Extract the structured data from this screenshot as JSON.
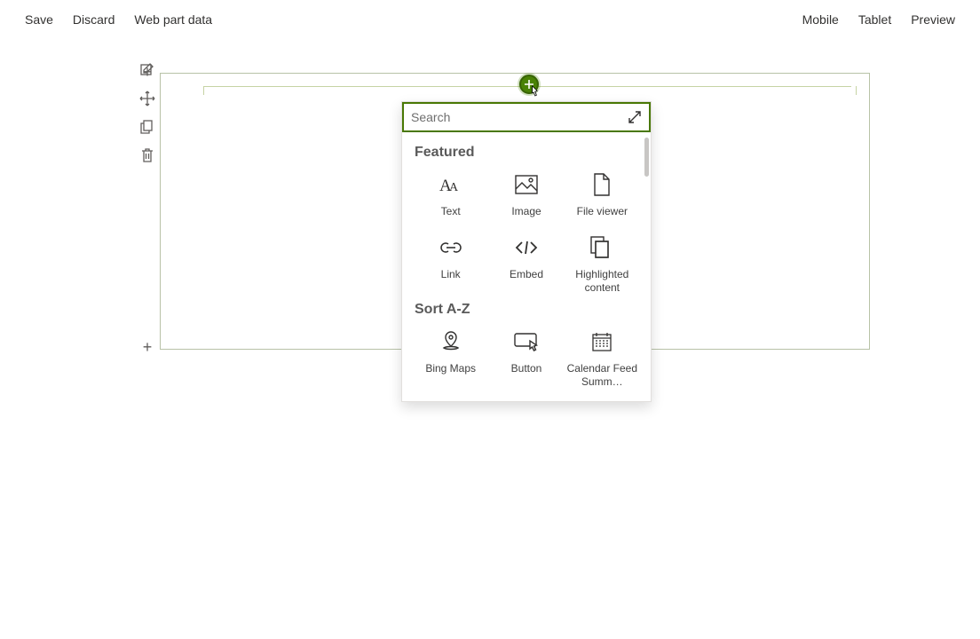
{
  "commandBar": {
    "left": {
      "save": "Save",
      "discard": "Discard",
      "webPartData": "Web part data"
    },
    "right": {
      "mobile": "Mobile",
      "tablet": "Tablet",
      "preview": "Preview"
    }
  },
  "picker": {
    "searchPlaceholder": "Search",
    "featuredHeading": "Featured",
    "sortHeading": "Sort A-Z",
    "featured": {
      "text": "Text",
      "image": "Image",
      "fileViewer": "File viewer",
      "link": "Link",
      "embed": "Embed",
      "highlighted": "Highlighted content"
    },
    "sort": {
      "bingMaps": "Bing Maps",
      "button": "Button",
      "calendar": "Calendar Feed Summ…"
    }
  },
  "colors": {
    "accent": "#498205"
  }
}
